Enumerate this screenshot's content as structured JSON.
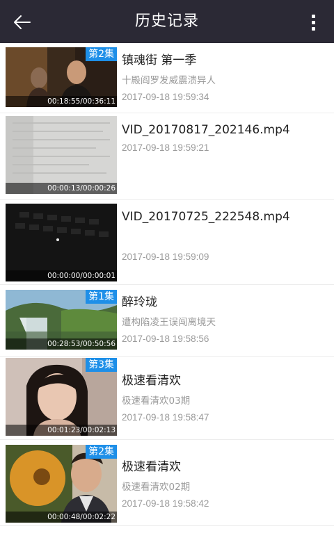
{
  "header": {
    "title": "历史记录",
    "back_icon": "arrow-left-icon",
    "more_icon": "vertical-dots-icon"
  },
  "history": [
    {
      "title": "镇魂街 第一季",
      "subtitle": "十殿阎罗发威震溃异人",
      "time": "2017-09-18 19:59:34",
      "episode": "第2集",
      "progress": "00:18:55/00:36:11"
    },
    {
      "title": "VID_20170817_202146.mp4",
      "subtitle": "",
      "time": "2017-09-18 19:59:21",
      "episode": "",
      "progress": "00:00:13/00:00:26"
    },
    {
      "title": "VID_20170725_222548.mp4",
      "subtitle": "",
      "time": "2017-09-18 19:59:09",
      "episode": "",
      "progress": "00:00:00/00:00:01"
    },
    {
      "title": "醉玲珑",
      "subtitle": "遭构陷凌王误闯离境天",
      "time": "2017-09-18 19:58:56",
      "episode": "第1集",
      "progress": "00:28:53/00:50:56"
    },
    {
      "title": "极速看清欢",
      "subtitle": "极速看清欢03期",
      "time": "2017-09-18 19:58:47",
      "episode": "第3集",
      "progress": "00:01:23/00:02:13"
    },
    {
      "title": "极速看清欢",
      "subtitle": "极速看清欢02期",
      "time": "2017-09-18 19:58:42",
      "episode": "第2集",
      "progress": "00:00:48/00:02:22"
    }
  ],
  "colors": {
    "header_bg": "#2b2935",
    "badge_bg": "#1e8fe8"
  }
}
